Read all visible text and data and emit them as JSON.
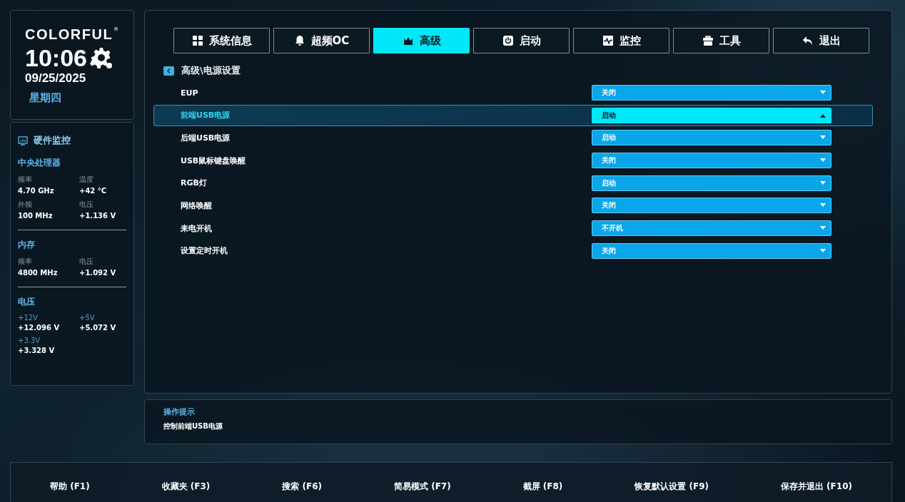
{
  "brand": {
    "logo": "COLORFUL",
    "registered": "®",
    "time": "10:06",
    "date": "09/25/2025",
    "weekday": "星期四"
  },
  "monitor": {
    "title": "硬件监控",
    "cpu": {
      "title": "中央处理器",
      "items": [
        {
          "label": "频率",
          "value": "4.70 GHz"
        },
        {
          "label": "温度",
          "value": "+42 °C"
        },
        {
          "label": "外频",
          "value": "100 MHz"
        },
        {
          "label": "电压",
          "value": "+1.136 V"
        }
      ]
    },
    "memory": {
      "title": "内存",
      "items": [
        {
          "label": "频率",
          "value": "4800 MHz"
        },
        {
          "label": "电压",
          "value": "+1.092 V"
        }
      ]
    },
    "voltage": {
      "title": "电压",
      "items": [
        {
          "label": "+12V",
          "value": "+12.096 V"
        },
        {
          "label": "+5V",
          "value": "+5.072 V"
        },
        {
          "label": "+3.3V",
          "value": "+3.328 V"
        }
      ]
    }
  },
  "tabs": [
    {
      "label": "系统信息",
      "selected": false
    },
    {
      "label": "超频OC",
      "selected": false
    },
    {
      "label": "高级",
      "selected": true
    },
    {
      "label": "启动",
      "selected": false
    },
    {
      "label": "监控",
      "selected": false
    },
    {
      "label": "工具",
      "selected": false
    },
    {
      "label": "退出",
      "selected": false
    }
  ],
  "breadcrumb": "高级\\电源设置",
  "settings": [
    {
      "label": "EUP",
      "value": "关闭",
      "selected": false
    },
    {
      "label": "前端USB电源",
      "value": "启动",
      "selected": true
    },
    {
      "label": "后端USB电源",
      "value": "启动",
      "selected": false
    },
    {
      "label": "USB鼠标键盘唤醒",
      "value": "关闭",
      "selected": false
    },
    {
      "label": "RGB灯",
      "value": "启动",
      "selected": false
    },
    {
      "label": "网络唤醒",
      "value": "关闭",
      "selected": false
    },
    {
      "label": "来电开机",
      "value": "不开机",
      "selected": false
    },
    {
      "label": "设置定时开机",
      "value": "关闭",
      "selected": false
    }
  ],
  "hint": {
    "title": "操作提示",
    "text": "控制前端USB电源"
  },
  "footer": [
    "帮助 (F1)",
    "收藏夹 (F3)",
    "搜索 (F6)",
    "简易模式 (F7)",
    "截屏 (F8)",
    "恢复默认设置 (F9)",
    "保存并退出 (F10)"
  ]
}
